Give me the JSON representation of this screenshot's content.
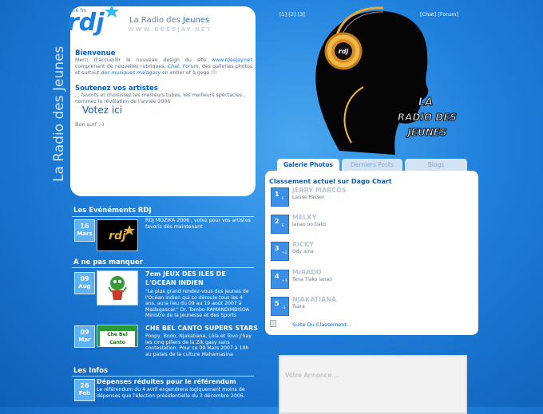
{
  "logo": {
    "text": "rdj",
    "freq": "96.6 fm",
    "brand": "La Radio des",
    "brand_accent": "Jeunes",
    "url": "WWW.RDEEJAY.NET"
  },
  "nav": {
    "pages": "[1] [2] [3]",
    "chat_forum": "[Chat] [Forum]"
  },
  "vertical_title": "La Radio des Jeunes",
  "welcome": {
    "heading": "Bienvenue",
    "text1": "Merci d'accueillir le nouveau design du site",
    "site": "www.rdeejay.net",
    "text2": "comprenant de nouvelles rubriques,",
    "chat": "Chat",
    "forum": "Forum",
    "text3": ", des galleries photos et surtout",
    "musiques": "des musiques malagasy",
    "text4": "en entier et à gogo !!!",
    "support_heading": "Soutenez vos artistes",
    "support_text": "... favorts et choisissez les meilleurs tubes, les meilleurs spéctacles , nommez la révélation de l'année 2006",
    "vote": "Votez ici",
    "signoff": "Bon surf :-)"
  },
  "events": {
    "heading": "Les Evénéments RDJ",
    "items": [
      {
        "day": "16",
        "month": "Mars",
        "text": "RDJ MOZIKA 2006 , votez pour vos artistes favoris dès maintenant"
      }
    ]
  },
  "notmiss": {
    "heading": "A ne pas manquer",
    "items": [
      {
        "day": "09",
        "month": "Aug",
        "title1": "7em JEUX DES ILES DE",
        "title2": "L'OCEAN INDIEN",
        "body": "\"Le plus grand rendez-vous des jeunes de l'Océan indien qui se déroule tous les 4 ans, aura lieu du 09 au 19 août 2007 à Madagascar.\" Dr. Tombo RAMANDIMBISOA Ministre de la Jeunesse et des Sports"
      },
      {
        "day": "09",
        "month": "Mar",
        "title1": "CHE BEL CANTO SUPERS STARS",
        "thumb_text": "Che Bel Canto",
        "body": "Poopy, Bodo, Njakatiana, Lôla et Tovo J'hay les cinq piliers de la Zik gasy sans contestation. Pour ce 09 Mars 2007 à 19h au palais de la culture Mahamasina"
      }
    ]
  },
  "infos": {
    "heading": "Les Infos",
    "items": [
      {
        "day": "26",
        "month": "Feb",
        "title": "Dépenses réduites pour le référendum",
        "body": "Le référendum du 4 avril engendrera logiquement moins de dépenses que l'élection présidentielle du 3 décembre 2006."
      }
    ]
  },
  "hero": {
    "line1": "LA",
    "line2": "RADIO DES",
    "line3": "JEUNES",
    "badge": "rdj"
  },
  "tabs": [
    "Galerie Photos",
    "Derniers Posts",
    "Blogs"
  ],
  "chart": {
    "title": "Classement actuel sur Dago Chart",
    "entries": [
      {
        "rank": "1",
        "change": "E",
        "artist": "JERRY MARCOS",
        "song": "Laisse Passer"
      },
      {
        "rank": "2",
        "change": "E",
        "artist": "MELKY",
        "song": "Ianao no tiako"
      },
      {
        "rank": "3",
        "change": "+2",
        "artist": "RICKY",
        "song": "Ody aina"
      },
      {
        "rank": "4",
        "change": "+3",
        "artist": "MIRADO",
        "song": "Tena Tiako ianao"
      },
      {
        "rank": "5",
        "change": "-1",
        "artist": "NJAKATIANA",
        "song": "Tsara"
      }
    ],
    "more": "Suite Du Classement..."
  },
  "annonce": "Votre Annonce...."
}
